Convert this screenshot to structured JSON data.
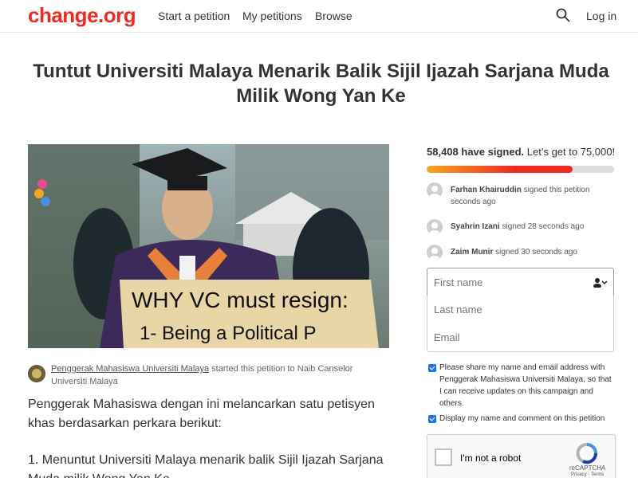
{
  "header": {
    "logo": "change.org",
    "nav": [
      "Start a petition",
      "My petitions",
      "Browse"
    ],
    "login": "Log in",
    "search_icon": "search-icon"
  },
  "petition": {
    "title": "Tuntut Universiti Malaya Menarik Balik Sijil Ijazah Sarjana Muda Milik Wong Yan Ke",
    "photo_sign_text_1": "WHY VC must resign:",
    "photo_sign_text_2": "1- Being a Political P",
    "starter_org": "Penggerak Mahasiswa Universiti Malaya",
    "starter_rest": " started this petition to Naib Canselor Universiti Malaya",
    "paragraph1": "Penggerak Mahasiswa dengan ini melancarkan satu petisyen khas berdasarkan perkara berikut:",
    "paragraph2": "1. Menuntut Universiti Malaya menarik balik Sijil Ijazah Sarjana Muda milik Wong Yan Ke"
  },
  "sidebar": {
    "signed_count": "58,408 have signed.",
    "signed_goal": " Let’s get to 75,000!",
    "progress_fraction": 0.779,
    "signers": [
      {
        "name": "Farhan Khairuddin",
        "action": " signed this petition",
        "time": "seconds ago"
      },
      {
        "name": "Syahrin Izani",
        "action": " signed 28 seconds ago",
        "time": ""
      },
      {
        "name": "Zaim Munir",
        "action": " signed 30 seconds ago",
        "time": ""
      }
    ],
    "form": {
      "first_name_placeholder": "First name",
      "last_name_placeholder": "Last name",
      "email_placeholder": "Email"
    },
    "checkbox1": "Please share my name and email address with Penggerak Mahasiswa Universiti Malaya, so that I can receive updates on this campaign and others.",
    "checkbox2": "Display my name and comment on this petition",
    "captcha": {
      "label": "I'm not a robot",
      "brand": "reCAPTCHA",
      "links": "Privacy - Terms"
    }
  },
  "colors": {
    "brand_red": "#ec2c22",
    "progress_start": "#f5a623",
    "checkbox_blue": "#1a73e8"
  }
}
